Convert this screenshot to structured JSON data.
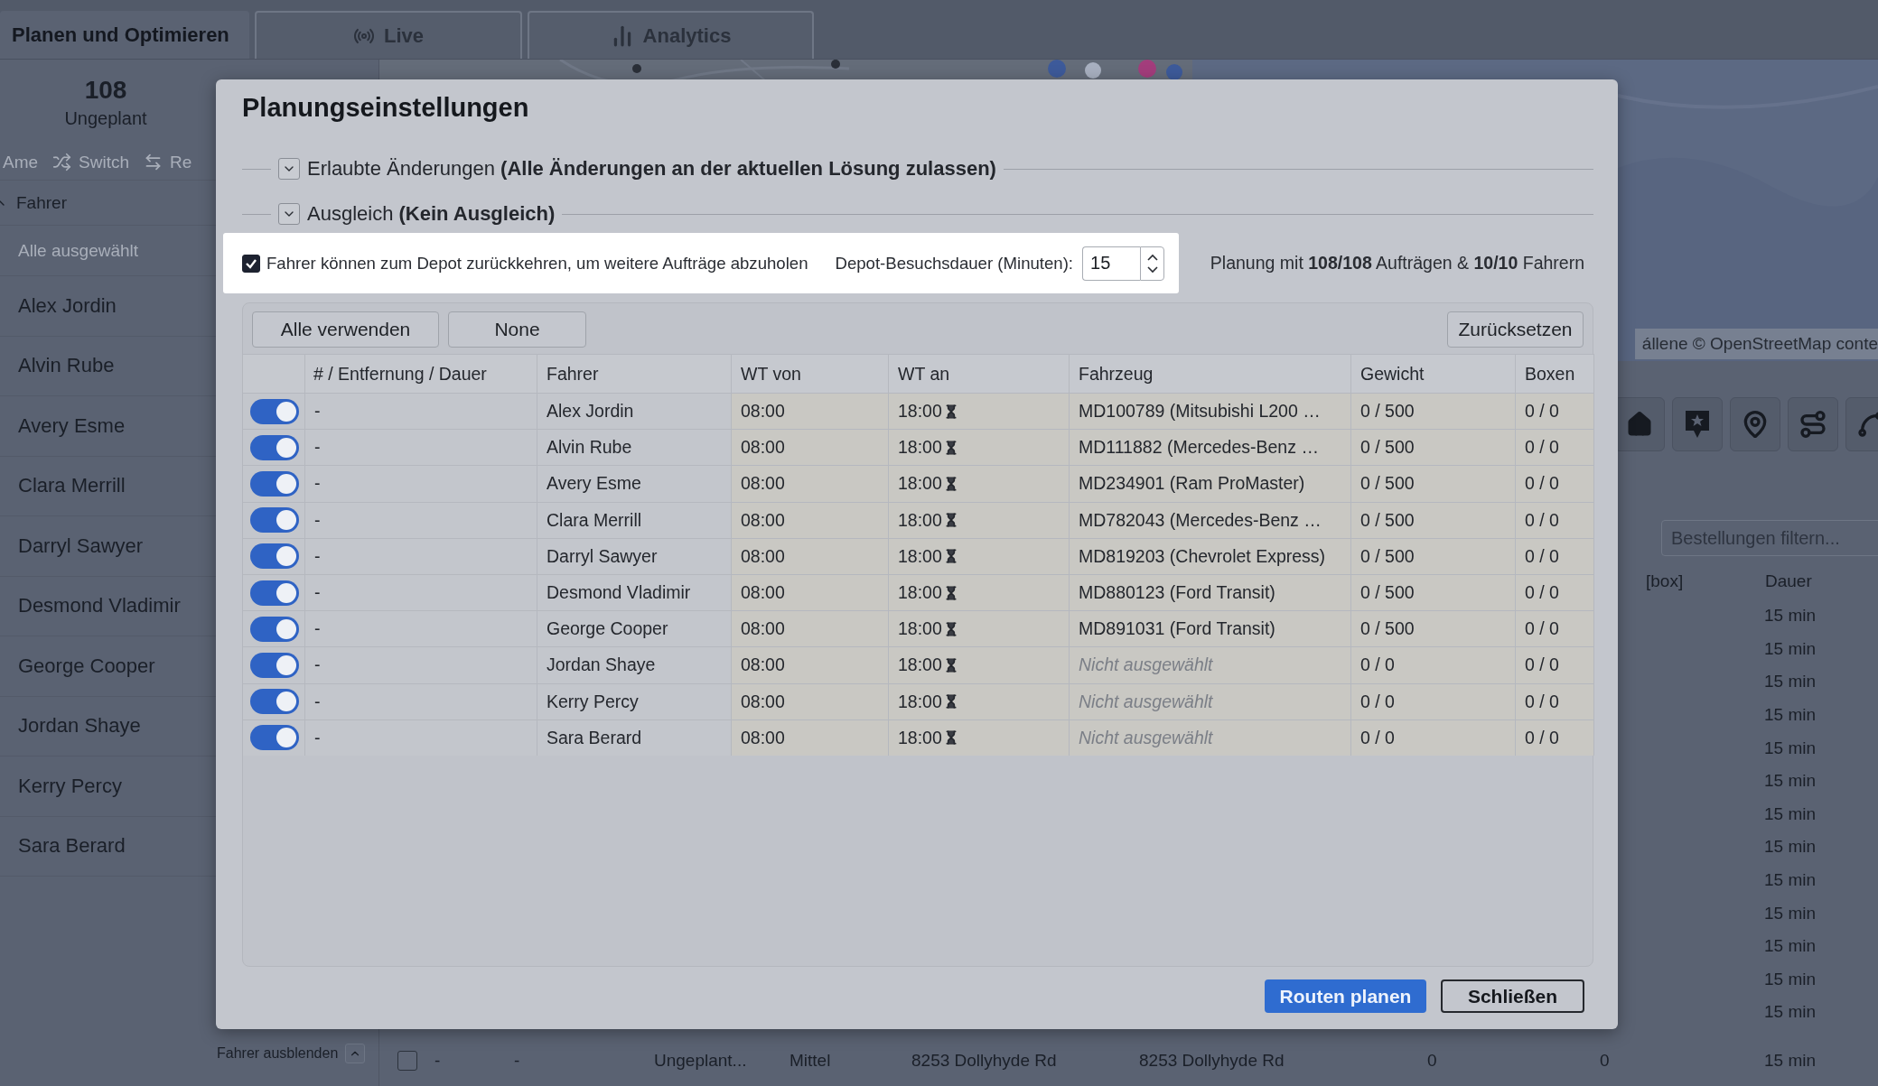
{
  "header": {
    "tabs": [
      {
        "label": "Planen und Optimieren",
        "selected": true
      },
      {
        "label": "Live",
        "selected": false
      },
      {
        "label": "Analytics",
        "selected": false
      }
    ]
  },
  "sidebar": {
    "stat": {
      "value": "108",
      "label": "Ungeplant"
    },
    "actions": [
      {
        "label": "Ame"
      },
      {
        "label": "Switch"
      },
      {
        "label": "Re"
      }
    ],
    "section": {
      "label": "Fahrer",
      "expanded": true
    },
    "all_label": "Alle ausgewählt",
    "drivers": [
      "Alex Jordin",
      "Alvin Rube",
      "Avery Esme",
      "Clara Merrill",
      "Darryl Sawyer",
      "Desmond Vladimir",
      "George Cooper",
      "Jordan Shaye",
      "Kerry Percy",
      "Sara Berard"
    ],
    "hide_button": {
      "label": "Fahrer ausblenden",
      "expanded": true
    }
  },
  "map": {
    "kind": "picture",
    "attribution": "állene © OpenStreetMap conte"
  },
  "order_filter": {
    "placeholder": "Bestellungen filtern..."
  },
  "orders": {
    "columns": [
      "[box]",
      "Dauer"
    ],
    "rows": [
      {
        "duration": "15 min"
      },
      {
        "duration": "15 min"
      },
      {
        "duration": "15 min"
      },
      {
        "duration": "15 min"
      },
      {
        "duration": "15 min"
      },
      {
        "duration": "15 min"
      },
      {
        "duration": "15 min"
      },
      {
        "duration": "15 min"
      },
      {
        "duration": "15 min"
      },
      {
        "duration": "15 min"
      },
      {
        "duration": "15 min"
      },
      {
        "duration": "15 min"
      },
      {
        "duration": "15 min"
      }
    ],
    "last_row": {
      "checked": false,
      "cells": [
        "-",
        "-",
        "Ungeplant...",
        "Mittel",
        "8253 Dollyhyde Rd",
        "8253 Dollyhyde Rd",
        "0",
        "0"
      ],
      "duration": "15 min"
    }
  },
  "dialog": {
    "title": "Planungseinstellungen",
    "sections": [
      {
        "text": "Erlaubte Änderungen **(Alle Änderungen an der aktuellen Lösung zulassen)**",
        "expanded": false
      },
      {
        "text": "Ausgleich **(Kein Ausgleich)**",
        "expanded": false
      }
    ],
    "depot_return": {
      "label": "Fahrer können zum Depot zurückkehren, um weitere Aufträge abzuholen",
      "checked": true
    },
    "visit_duration": {
      "label": "Depot-Besuchsdauer (Minuten):",
      "value": "15"
    },
    "summary": "Planung mit **108/108** Aufträgen & **10/10** Fahrern",
    "left_buttons": [
      "Alle verwenden",
      "None"
    ],
    "reset_button": "Zurücksetzen",
    "columns": [
      "# / Entfernung / Dauer",
      "Fahrer",
      "WT von",
      "WT an",
      "Fahrzeug",
      "Gewicht",
      "Boxen"
    ],
    "rows": [
      {
        "on": true,
        "distance": "-",
        "driver": "Alex Jordin",
        "from": "08:00",
        "to": "18:00",
        "vehicle": "MD100789 (Mitsubishi L200 …",
        "vehicle_selected": true,
        "weight": "0 / 500",
        "boxes": "0 / 0"
      },
      {
        "on": true,
        "distance": "-",
        "driver": "Alvin Rube",
        "from": "08:00",
        "to": "18:00",
        "vehicle": "MD111882 (Mercedes-Benz …",
        "vehicle_selected": true,
        "weight": "0 / 500",
        "boxes": "0 / 0"
      },
      {
        "on": true,
        "distance": "-",
        "driver": "Avery Esme",
        "from": "08:00",
        "to": "18:00",
        "vehicle": "MD234901 (Ram ProMaster)",
        "vehicle_selected": true,
        "weight": "0 / 500",
        "boxes": "0 / 0"
      },
      {
        "on": true,
        "distance": "-",
        "driver": "Clara Merrill",
        "from": "08:00",
        "to": "18:00",
        "vehicle": "MD782043 (Mercedes-Benz …",
        "vehicle_selected": true,
        "weight": "0 / 500",
        "boxes": "0 / 0"
      },
      {
        "on": true,
        "distance": "-",
        "driver": "Darryl Sawyer",
        "from": "08:00",
        "to": "18:00",
        "vehicle": "MD819203 (Chevrolet Express)",
        "vehicle_selected": true,
        "weight": "0 / 500",
        "boxes": "0 / 0"
      },
      {
        "on": true,
        "distance": "-",
        "driver": "Desmond Vladimir",
        "from": "08:00",
        "to": "18:00",
        "vehicle": "MD880123 (Ford Transit)",
        "vehicle_selected": true,
        "weight": "0 / 500",
        "boxes": "0 / 0"
      },
      {
        "on": true,
        "distance": "-",
        "driver": "George Cooper",
        "from": "08:00",
        "to": "18:00",
        "vehicle": "MD891031 (Ford Transit)",
        "vehicle_selected": true,
        "weight": "0 / 500",
        "boxes": "0 / 0"
      },
      {
        "on": true,
        "distance": "-",
        "driver": "Jordan Shaye",
        "from": "08:00",
        "to": "18:00",
        "vehicle": "Nicht ausgewählt",
        "vehicle_selected": false,
        "weight": "0 / 0",
        "boxes": "0 / 0"
      },
      {
        "on": true,
        "distance": "-",
        "driver": "Kerry Percy",
        "from": "08:00",
        "to": "18:00",
        "vehicle": "Nicht ausgewählt",
        "vehicle_selected": false,
        "weight": "0 / 0",
        "boxes": "0 / 0"
      },
      {
        "on": true,
        "distance": "-",
        "driver": "Sara Berard",
        "from": "08:00",
        "to": "18:00",
        "vehicle": "Nicht ausgewählt",
        "vehicle_selected": false,
        "weight": "0 / 0",
        "boxes": "0 / 0"
      }
    ],
    "footer_buttons": [
      {
        "label": "Routen planen",
        "kind": "primary"
      },
      {
        "label": "Schließen",
        "kind": "secondary"
      }
    ]
  }
}
